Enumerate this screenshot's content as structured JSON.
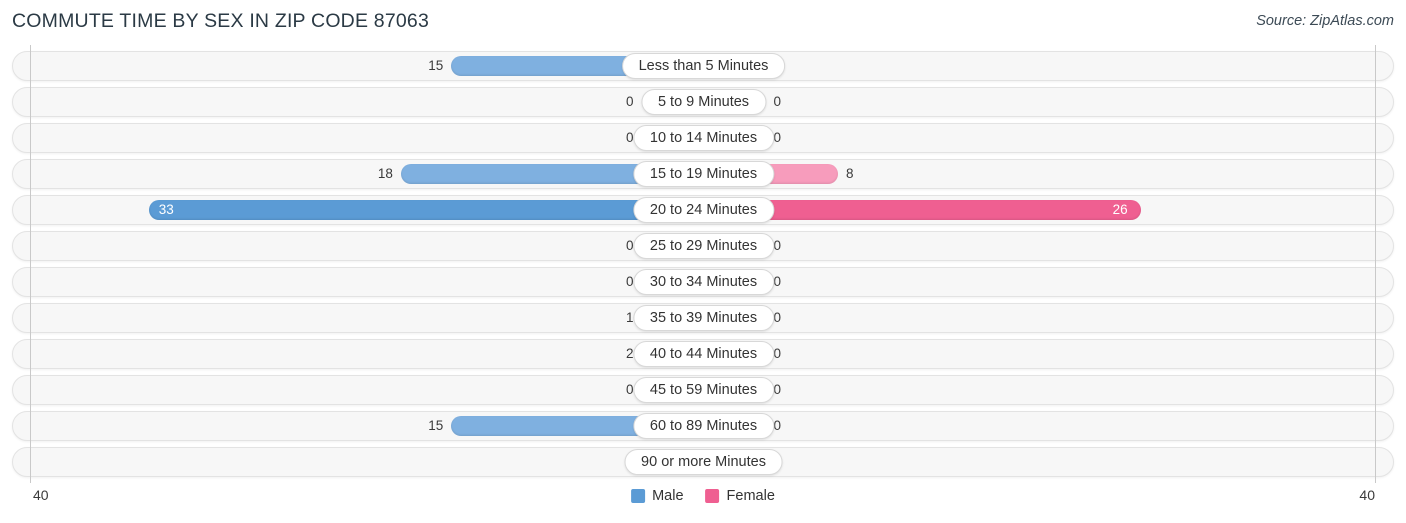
{
  "header": {
    "title": "COMMUTE TIME BY SEX IN ZIP CODE 87063",
    "source": "Source: ZipAtlas.com"
  },
  "axis": {
    "left_tick": "40",
    "right_tick": "40"
  },
  "legend": {
    "male_label": "Male",
    "female_label": "Female",
    "male_color": "#5b9bd5",
    "female_color": "#ef5f91"
  },
  "colors": {
    "male_bar": "#7fb0e0",
    "male_bar_zero": "#a9c9ec",
    "male_bar_max": "#5b9bd5",
    "female_bar": "#f79cbc",
    "female_bar_zero": "#f79cbc",
    "female_bar_max": "#ef5f91",
    "row_background": "#f7f7f7",
    "pill_background": "#ffffff"
  },
  "chart_data": {
    "type": "bar",
    "title": "COMMUTE TIME BY SEX IN ZIP CODE 87063",
    "subtitle": "",
    "xlabel": "",
    "ylabel": "",
    "orientation": "horizontal-diverging",
    "axis_max": 40,
    "xlim": [
      40,
      0,
      40
    ],
    "grid": false,
    "legend_position": "bottom-center",
    "categories": [
      "Less than 5 Minutes",
      "5 to 9 Minutes",
      "10 to 14 Minutes",
      "15 to 19 Minutes",
      "20 to 24 Minutes",
      "25 to 29 Minutes",
      "30 to 34 Minutes",
      "35 to 39 Minutes",
      "40 to 44 Minutes",
      "45 to 59 Minutes",
      "60 to 89 Minutes",
      "90 or more Minutes"
    ],
    "series": [
      {
        "name": "Male",
        "values": [
          15,
          0,
          0,
          18,
          33,
          0,
          0,
          1,
          2,
          0,
          15,
          0
        ]
      },
      {
        "name": "Female",
        "values": [
          0,
          0,
          0,
          8,
          26,
          0,
          0,
          0,
          0,
          0,
          0,
          0
        ]
      }
    ]
  },
  "rows": [
    {
      "label": "Less than 5 Minutes",
      "male": "15",
      "female": "0"
    },
    {
      "label": "5 to 9 Minutes",
      "male": "0",
      "female": "0"
    },
    {
      "label": "10 to 14 Minutes",
      "male": "0",
      "female": "0"
    },
    {
      "label": "15 to 19 Minutes",
      "male": "18",
      "female": "8"
    },
    {
      "label": "20 to 24 Minutes",
      "male": "33",
      "female": "26"
    },
    {
      "label": "25 to 29 Minutes",
      "male": "0",
      "female": "0"
    },
    {
      "label": "30 to 34 Minutes",
      "male": "0",
      "female": "0"
    },
    {
      "label": "35 to 39 Minutes",
      "male": "1",
      "female": "0"
    },
    {
      "label": "40 to 44 Minutes",
      "male": "2",
      "female": "0"
    },
    {
      "label": "45 to 59 Minutes",
      "male": "0",
      "female": "0"
    },
    {
      "label": "60 to 89 Minutes",
      "male": "15",
      "female": "0"
    },
    {
      "label": "90 or more Minutes",
      "male": "0",
      "female": "0"
    }
  ]
}
